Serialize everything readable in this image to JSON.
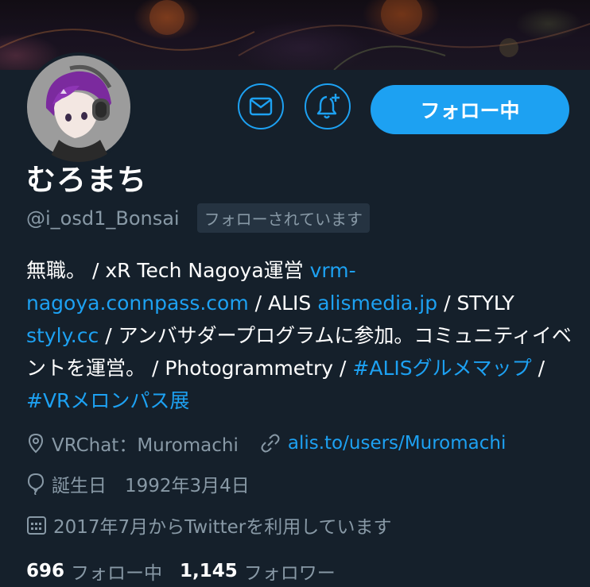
{
  "profile": {
    "display_name": "むろまち",
    "handle": "@i_osd1_Bonsai",
    "follows_you": "フォローされています",
    "follow_button": "フォロー中"
  },
  "bio": {
    "t1": "無職。 / xR Tech Nagoya運営 ",
    "l1": "vrm-nagoya.connpass.com",
    "t2": " / ALIS ",
    "l2": "alismedia.jp",
    "t3": " / STYLY ",
    "l3": "styly.cc",
    "t4": " / アンバサダープログラムに参加。コミュニティイベントを運営。 / Photogrammetry / ",
    "l4": "#ALISグルメマップ",
    "t5": " / ",
    "l5": "#VRメロンパス展"
  },
  "meta": {
    "location": "VRChat：Muromachi",
    "website": "alis.to/users/Muromachi",
    "birthday": "誕生日　1992年3月4日",
    "joined": "2017年7月からTwitterを利用しています"
  },
  "stats": {
    "following_count": "696",
    "following_label": "フォロー中",
    "followers_count": "1,145",
    "followers_label": "フォロワー"
  },
  "colors": {
    "background": "#15202b",
    "accent": "#1da1f2",
    "secondary_text": "#8899a6"
  },
  "icons": [
    "mail-icon",
    "notification-bell-plus-icon",
    "location-pin-icon",
    "link-icon",
    "balloon-icon",
    "calendar-icon"
  ]
}
